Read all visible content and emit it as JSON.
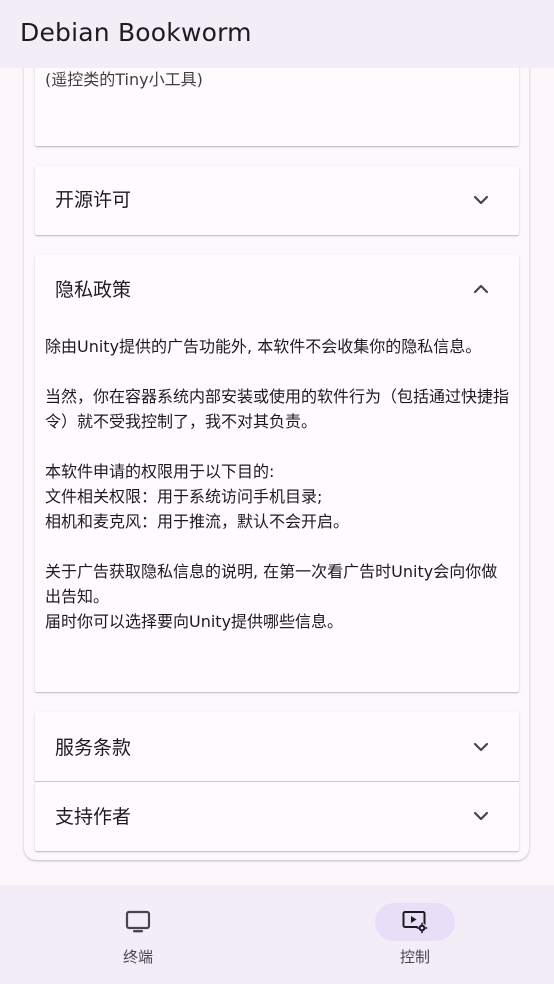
{
  "app_bar": {
    "title": "Debian Bookworm"
  },
  "clipped_previous": {
    "text": "(遥控类的Tiny小工具)"
  },
  "sections": {
    "open_source": {
      "title": "开源许可",
      "expanded": false,
      "icon": "chevron-down-icon"
    },
    "privacy": {
      "title": "隐私政策",
      "expanded": true,
      "icon": "chevron-up-icon",
      "body": [
        "除由Unity提供的广告功能外, 本软件不会收集你的隐私信息。",
        "",
        "当然，你在容器系统内部安装或使用的软件行为（包括通过快捷指令）就不受我控制了，我不对其负责。",
        "",
        "本软件申请的权限用于以下目的:",
        "文件相关权限：用于系统访问手机目录;",
        "相机和麦克风：用于推流，默认不会开启。",
        "",
        "关于广告获取隐私信息的说明, 在第一次看广告时Unity会向你做出告知。",
        "届时你可以选择要向Unity提供哪些信息。"
      ]
    },
    "terms": {
      "title": "服务条款",
      "expanded": false,
      "icon": "chevron-down-icon"
    },
    "support": {
      "title": "支持作者",
      "expanded": false,
      "icon": "chevron-down-icon"
    }
  },
  "bottom_nav": {
    "items": [
      {
        "label": "终端",
        "icon": "monitor-icon",
        "active": false
      },
      {
        "label": "控制",
        "icon": "video-settings-icon",
        "active": true
      }
    ]
  },
  "colors": {
    "background": "#fdf7fb",
    "bar": "#f3edf7",
    "active_pill": "#e8def8",
    "text": "#1c1b1f",
    "secondary_text": "#49454f"
  }
}
